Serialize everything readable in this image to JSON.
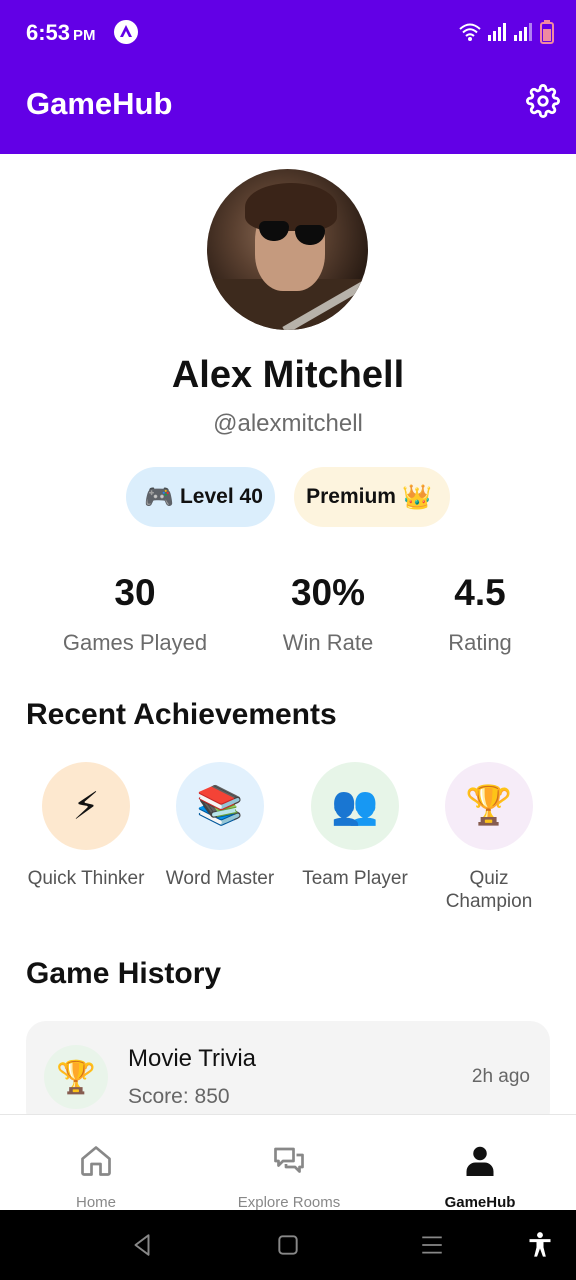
{
  "status_bar": {
    "time": "6:53",
    "ampm": "PM"
  },
  "app_bar": {
    "title": "GameHub"
  },
  "profile": {
    "name": "Alex Mitchell",
    "handle": "@alexmitchell",
    "level_badge": {
      "emoji": "🎮",
      "label": "Level 40"
    },
    "premium_badge": {
      "label": "Premium",
      "emoji": "👑"
    }
  },
  "stats": [
    {
      "value": "30",
      "label": "Games Played"
    },
    {
      "value": "30%",
      "label": "Win Rate"
    },
    {
      "value": "4.5",
      "label": "Rating"
    }
  ],
  "achievements": {
    "title": "Recent Achievements",
    "items": [
      {
        "emoji": "⚡",
        "label": "Quick Thinker",
        "color": "#fde8cf",
        "icon": "lightning-icon"
      },
      {
        "emoji": "📚",
        "label": "Word Master",
        "color": "#e2f1fd",
        "icon": "books-icon"
      },
      {
        "emoji": "👥",
        "label": "Team Player",
        "color": "#e7f5e8",
        "icon": "people-icon"
      },
      {
        "emoji": "🏆",
        "label": "Quiz Champion",
        "color": "#f6ecf8",
        "icon": "trophy-icon"
      }
    ]
  },
  "history": {
    "title": "Game History",
    "items": [
      {
        "emoji": "🏆",
        "game": "Movie Trivia",
        "score": "Score: 850",
        "time": "2h ago"
      }
    ]
  },
  "bottom_nav": [
    {
      "label": "Home",
      "icon": "home-icon",
      "active": false
    },
    {
      "label": "Explore Rooms",
      "icon": "chat-bubbles-icon",
      "active": false
    },
    {
      "label": "GameHub",
      "icon": "person-icon",
      "active": true
    }
  ],
  "colors": {
    "primary": "#6200e6",
    "text": "#111111",
    "muted": "#6b6b6b"
  }
}
